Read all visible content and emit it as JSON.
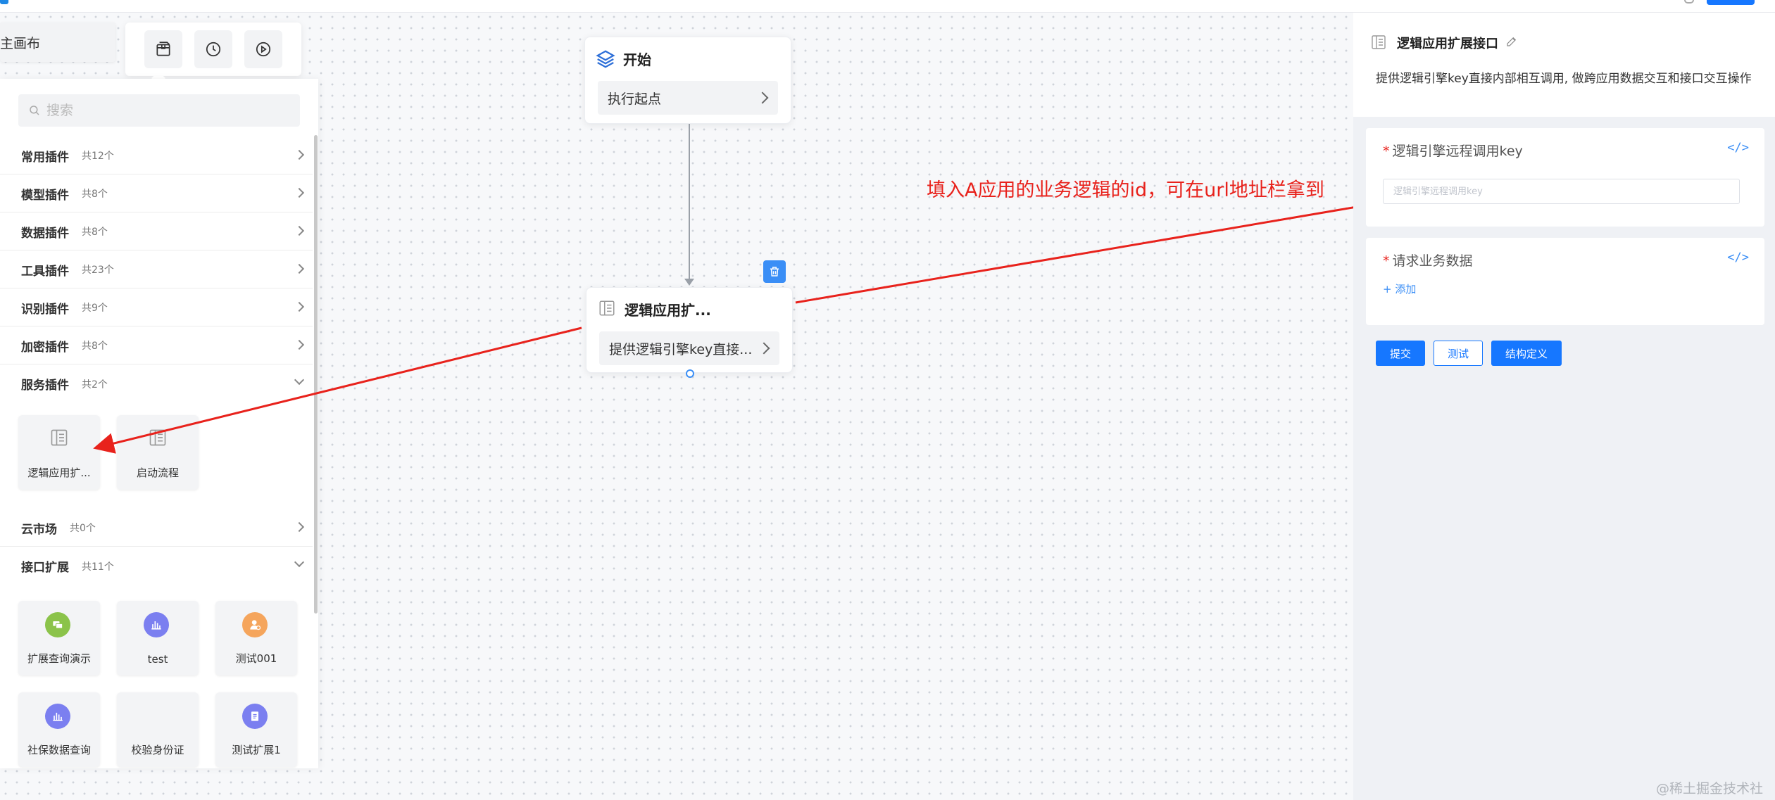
{
  "canvas_tab": {
    "label": "主画布"
  },
  "toolbar": {
    "buttons": [
      {
        "icon": "package-icon"
      },
      {
        "icon": "history-clock-icon"
      },
      {
        "icon": "play-circle-icon"
      }
    ]
  },
  "plugin_panel": {
    "search_placeholder": "搜索",
    "categories": [
      {
        "name": "常用插件",
        "count": "共12个",
        "expanded": false
      },
      {
        "name": "模型插件",
        "count": "共8个",
        "expanded": false
      },
      {
        "name": "数据插件",
        "count": "共8个",
        "expanded": false
      },
      {
        "name": "工具插件",
        "count": "共23个",
        "expanded": false
      },
      {
        "name": "识别插件",
        "count": "共9个",
        "expanded": false
      },
      {
        "name": "加密插件",
        "count": "共8个",
        "expanded": false
      },
      {
        "name": "服务插件",
        "count": "共2个",
        "expanded": true
      },
      {
        "name": "云市场",
        "count": "共0个",
        "expanded": false
      },
      {
        "name": "接口扩展",
        "count": "共11个",
        "expanded": true
      }
    ],
    "service_plugins": [
      {
        "label": "逻辑应用扩...",
        "icon": "document-icon"
      },
      {
        "label": "启动流程",
        "icon": "document-icon"
      }
    ],
    "interface_extensions": [
      {
        "label": "扩展查询演示",
        "icon": "chat-icon",
        "color": "#8bc34a"
      },
      {
        "label": "test",
        "icon": "chart-icon",
        "color": "#7b7ff0"
      },
      {
        "label": "测试001",
        "icon": "user-icon",
        "color": "#f5a55c"
      },
      {
        "label": "社保数据查询",
        "icon": "chart-icon",
        "color": "#7b7ff0"
      },
      {
        "label": "校验身份证",
        "icon": "",
        "color": ""
      },
      {
        "label": "测试扩展1",
        "icon": "form-icon",
        "color": "#7b7ff0"
      }
    ]
  },
  "flow": {
    "start_node": {
      "title": "开始",
      "content": "执行起点"
    },
    "logic_node": {
      "title": "逻辑应用扩...",
      "content": "提供逻辑引擎key直接..."
    }
  },
  "annotation": {
    "text": "填入A应用的业务逻辑的id，可在url地址栏拿到",
    "color": "#e8221c"
  },
  "config_panel": {
    "title": "逻辑应用扩展接口",
    "description": "提供逻辑引擎key直接内部相互调用, 做跨应用数据交互和接口交互操作",
    "fields": [
      {
        "label": "逻辑引擎远程调用key",
        "required": true,
        "placeholder": "逻辑引擎远程调用key",
        "value": ""
      },
      {
        "label": "请求业务数据",
        "required": true,
        "add_label": "+ 添加"
      }
    ],
    "code_toggle": "</>",
    "buttons": {
      "submit": "提交",
      "test": "测试",
      "schema": "结构定义"
    }
  },
  "watermark": "@稀土掘金技术社区",
  "colors": {
    "primary": "#1677ff",
    "canvas": "#f7f8fa",
    "panel_bg": "#eff1f5"
  }
}
